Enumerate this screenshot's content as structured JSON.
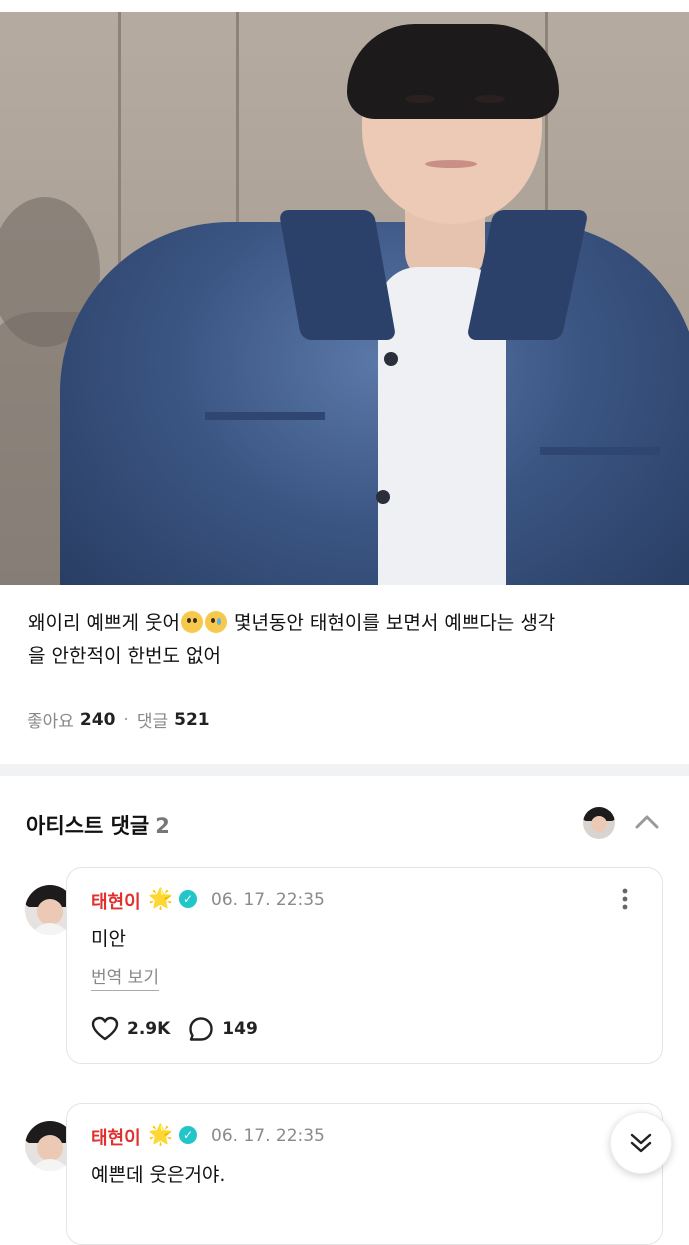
{
  "post": {
    "caption_line1": "왜이리 예쁘게 웃어",
    "caption_after_emoji": " 몇년동안 태현이를 보면서 예쁘다는 생각",
    "caption_line2": "을 안한적이 한번도 없어",
    "likes_label": "좋아요",
    "likes_count": "240",
    "comments_label": "댓글",
    "comments_count": "521",
    "separator": "·"
  },
  "artist_section": {
    "title": "아티스트 댓글",
    "count": "2"
  },
  "comments": [
    {
      "author": "태현이",
      "badge_emoji": "🌟",
      "timestamp": "06. 17. 22:35",
      "text": "미안",
      "translate_label": "번역 보기",
      "likes": "2.9K",
      "replies": "149"
    },
    {
      "author": "태현이",
      "badge_emoji": "🌟",
      "timestamp": "06. 17. 22:35",
      "text": "예쁜데 웃은거야."
    }
  ],
  "icons": {
    "heart": "heart-icon",
    "reply": "speech-bubble-icon",
    "more": "more-vertical-icon",
    "collapse": "chevron-up-icon",
    "scroll_down": "double-chevron-down-icon",
    "verified": "verified-check-icon"
  },
  "colors": {
    "author_name": "#e0312d",
    "verified_badge": "#22c6c9",
    "muted_text": "#888888",
    "divider": "#f1f2f4"
  }
}
